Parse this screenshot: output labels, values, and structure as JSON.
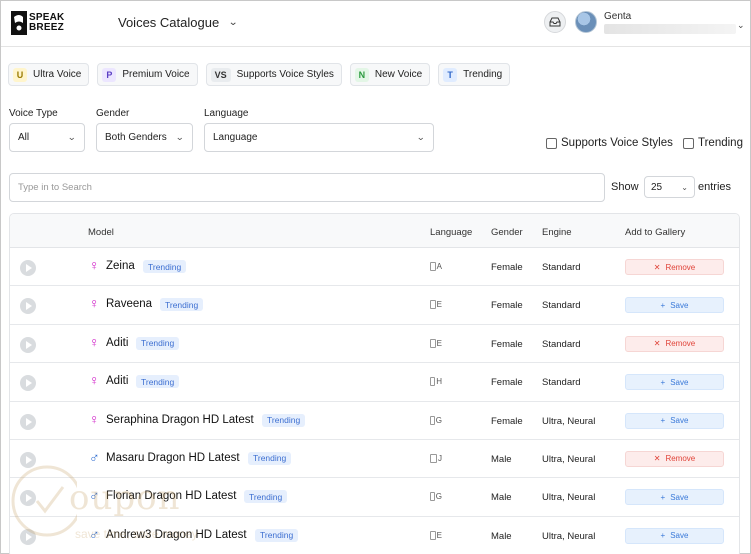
{
  "header": {
    "logo_line1": "SPEAK",
    "logo_line2": "BREEZ",
    "title": "Voices Catalogue",
    "user_name": "Genta"
  },
  "chips": [
    {
      "badge": "U",
      "label": "Ultra Voice"
    },
    {
      "badge": "P",
      "label": "Premium Voice"
    },
    {
      "badge": "VS",
      "label": "Supports Voice Styles"
    },
    {
      "badge": "N",
      "label": "New Voice"
    },
    {
      "badge": "T",
      "label": "Trending"
    }
  ],
  "filters": {
    "voice_type": {
      "label": "Voice Type",
      "value": "All"
    },
    "gender": {
      "label": "Gender",
      "value": "Both Genders"
    },
    "language": {
      "label": "Language",
      "value": "Language"
    },
    "supports_voice_styles_label": "Supports Voice Styles",
    "trending_label": "Trending"
  },
  "search": {
    "placeholder": "Type in to Search"
  },
  "pagination": {
    "show_label": "Show",
    "entries_value": "25",
    "entries_label": "entries"
  },
  "table": {
    "columns": {
      "model": "Model",
      "language": "Language",
      "gender": "Gender",
      "engine": "Engine",
      "gallery": "Add to Gallery"
    },
    "rows": [
      {
        "name": "Zeina",
        "badge": "Trending",
        "lang_alt": "A",
        "gender": "Female",
        "engine": "Standard",
        "action": "Remove"
      },
      {
        "name": "Raveena",
        "badge": "Trending",
        "lang_alt": "E",
        "gender": "Female",
        "engine": "Standard",
        "action": "Save"
      },
      {
        "name": "Aditi",
        "badge": "Trending",
        "lang_alt": "E",
        "gender": "Female",
        "engine": "Standard",
        "action": "Remove"
      },
      {
        "name": "Aditi",
        "badge": "Trending",
        "lang_alt": "H",
        "gender": "Female",
        "engine": "Standard",
        "action": "Save"
      },
      {
        "name": "Seraphina Dragon HD Latest",
        "badge": "Trending",
        "lang_alt": "G",
        "gender": "Female",
        "engine": "Ultra, Neural",
        "action": "Save"
      },
      {
        "name": "Masaru Dragon HD Latest",
        "badge": "Trending",
        "lang_alt": "J",
        "gender": "Male",
        "engine": "Ultra, Neural",
        "action": "Remove"
      },
      {
        "name": "Florian Dragon HD Latest",
        "badge": "Trending",
        "lang_alt": "G",
        "gender": "Male",
        "engine": "Ultra, Neural",
        "action": "Save"
      },
      {
        "name": "Andrew3 Dragon HD Latest",
        "badge": "Trending",
        "lang_alt": "E",
        "gender": "Male",
        "engine": "Ultra, Neural",
        "action": "Save"
      }
    ]
  },
  "icons": {
    "female": "female-symbol",
    "male": "male-symbol",
    "play": "play-icon",
    "inbox": "inbox-icon"
  },
  "colors": {
    "female": "#d020c8",
    "male": "#2f6dd0",
    "trending_bg": "#e6effd",
    "remove": "#e0443a",
    "save": "#3b7ad9"
  },
  "watermark": {
    "text": "oupon",
    "subtext": "save time, save money"
  }
}
